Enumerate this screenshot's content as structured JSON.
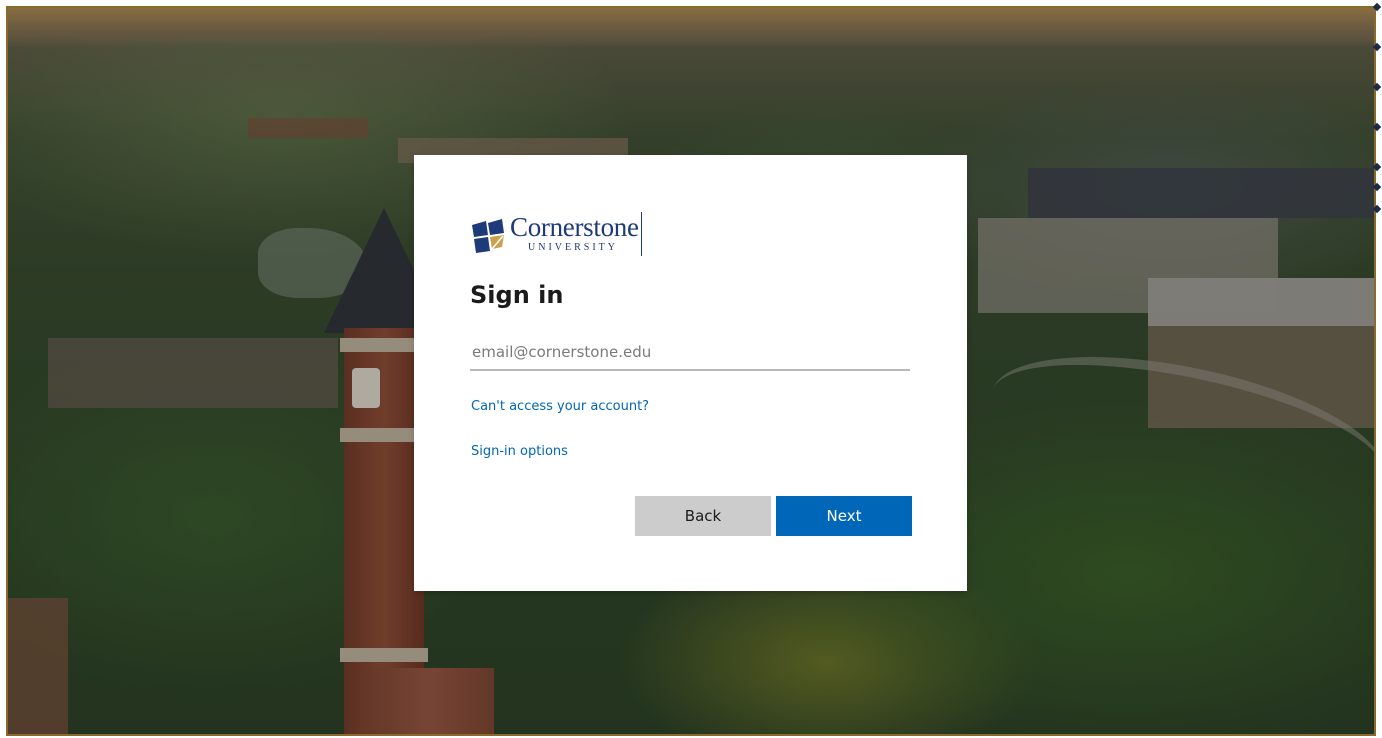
{
  "brand": {
    "name": "Cornerstone",
    "subtitle": "UNIVERSITY",
    "mark_colors": [
      "#1e3a78",
      "#c9a24a"
    ]
  },
  "signin": {
    "title": "Sign in",
    "email_placeholder": "email@cornerstone.edu",
    "email_value": "",
    "cant_access_link": "Can't access your account?",
    "options_link": "Sign-in options",
    "back_label": "Back",
    "next_label": "Next"
  },
  "colors": {
    "accent": "#0067b8",
    "secondary_button": "#cccccc",
    "brand_navy": "#1e3a78",
    "brand_gold": "#c9a24a"
  }
}
